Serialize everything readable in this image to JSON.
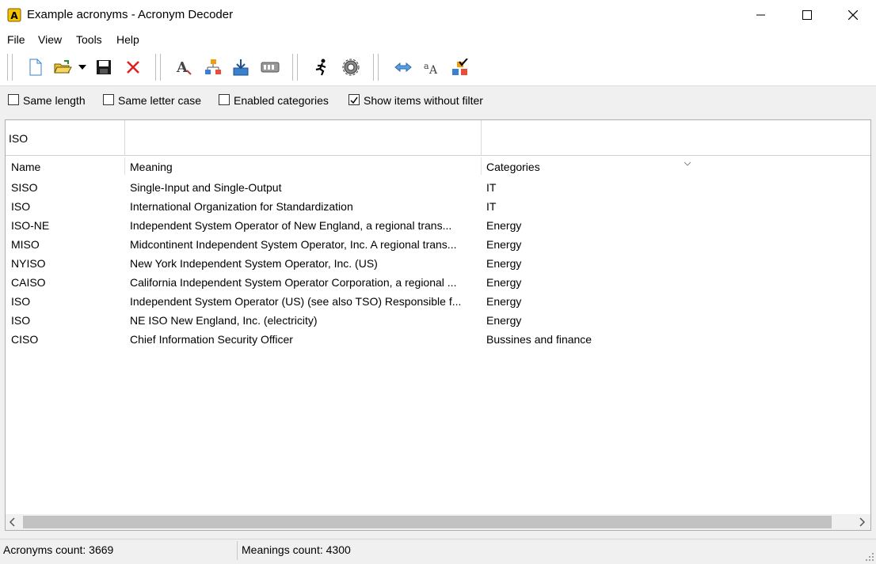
{
  "window": {
    "title": "Example acronyms - Acronym Decoder"
  },
  "menu": [
    "File",
    "View",
    "Tools",
    "Help"
  ],
  "toolbar": {
    "buttons": [
      "new-file",
      "open-folder",
      "open-dropdown",
      "save",
      "delete",
      "font",
      "categories",
      "import",
      "keyboard",
      "run",
      "settings",
      "swap",
      "letter-case",
      "check-categories"
    ]
  },
  "filters": {
    "same_length": {
      "label": "Same length",
      "checked": false
    },
    "same_letter_case": {
      "label": "Same letter case",
      "checked": false
    },
    "enabled_categories": {
      "label": "Enabled categories",
      "checked": false
    },
    "show_items_without_filter": {
      "label": "Show items without filter",
      "checked": true
    }
  },
  "search": {
    "name_filter": "ISO"
  },
  "table": {
    "columns": [
      "Name",
      "Meaning",
      "Categories"
    ],
    "rows": [
      [
        "SISO",
        "Single-Input and Single-Output",
        "IT"
      ],
      [
        "ISO",
        "International Organization for Standardization",
        "IT"
      ],
      [
        "ISO-NE",
        "Independent System Operator of New England, a regional trans...",
        "Energy"
      ],
      [
        "MISO",
        "Midcontinent Independent System Operator, Inc. A regional trans...",
        "Energy"
      ],
      [
        "NYISO",
        "New York Independent System Operator, Inc. (US)",
        "Energy"
      ],
      [
        "CAISO",
        "California Independent System Operator Corporation, a regional ...",
        "Energy"
      ],
      [
        "ISO",
        "Independent System Operator (US) (see also TSO) Responsible f...",
        "Energy"
      ],
      [
        "ISO",
        "NE ISO New England, Inc. (electricity)",
        "Energy"
      ],
      [
        "CISO",
        "Chief Information Security Officer",
        "Bussines and finance"
      ]
    ]
  },
  "status": {
    "acronyms": "Acronyms count: 3669",
    "meanings": "Meanings count: 4300"
  }
}
